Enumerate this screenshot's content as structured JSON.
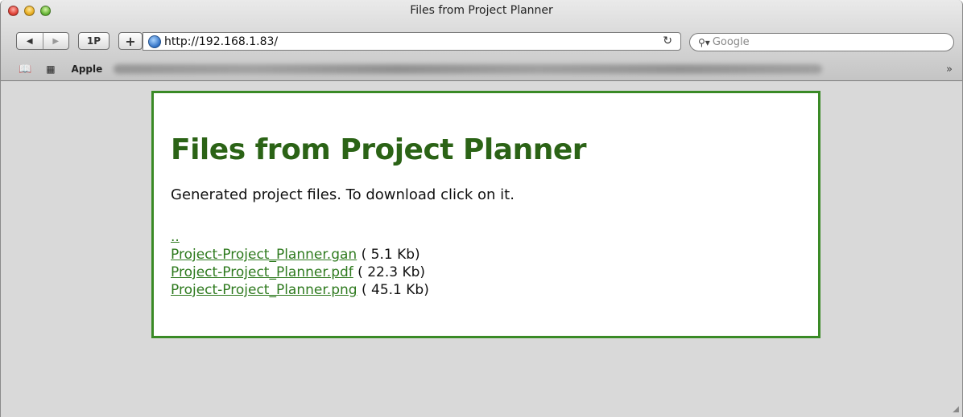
{
  "window": {
    "title": "Files from Project Planner"
  },
  "toolbar": {
    "back_label": "◀",
    "forward_label": "▶",
    "onepassword_label": "1P",
    "add_label": "+",
    "url": "http://192.168.1.83/",
    "reload_label": "↻",
    "search_placeholder": "Google"
  },
  "bookmarks": {
    "first_label": "Apple",
    "overflow_label": "»"
  },
  "page": {
    "heading": "Files from Project Planner",
    "description": "Generated project files. To download click on it.",
    "parent_link": "..",
    "files": [
      {
        "name": "Project-Project_Planner.gan",
        "size": "( 5.1 Kb)"
      },
      {
        "name": "Project-Project_Planner.pdf",
        "size": "( 22.3 Kb)"
      },
      {
        "name": "Project-Project_Planner.png",
        "size": "( 45.1 Kb)"
      }
    ]
  },
  "colors": {
    "accent_border": "#3a8a26",
    "heading": "#2b6316",
    "link": "#2e7a1e"
  }
}
